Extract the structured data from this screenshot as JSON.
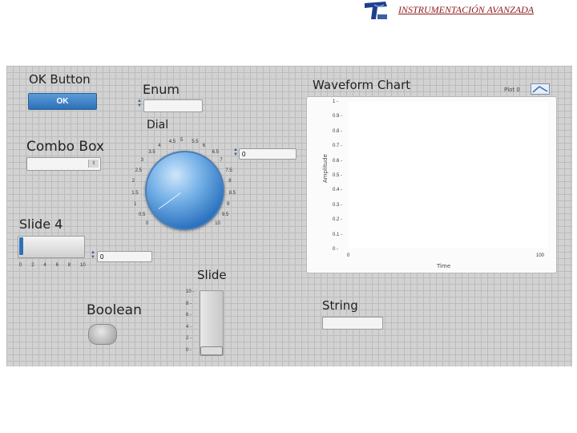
{
  "header": {
    "title": "INSTRUMENTACIÓN AVANZADA",
    "logo_icon": "institution-logo-icon"
  },
  "controls": {
    "ok_button": {
      "label": "OK Button",
      "text": "OK"
    },
    "enum": {
      "label": "Enum",
      "value": ""
    },
    "dial": {
      "label": "Dial",
      "value": "0",
      "ticks": [
        "0",
        "0.5",
        "1",
        "1.5",
        "2",
        "2.5",
        "3",
        "3.5",
        "4",
        "4.5",
        "5",
        "5.5",
        "6",
        "6.5",
        "7",
        "7.5",
        "8",
        "8.5",
        "9",
        "9.5",
        "10"
      ],
      "level": 0.4
    },
    "combo_box": {
      "label": "Combo Box",
      "value": ""
    },
    "slide4": {
      "label": "Slide 4",
      "value": "0",
      "ticks": [
        "0",
        "2",
        "4",
        "6",
        "8",
        "10"
      ]
    },
    "slide": {
      "label": "Slide",
      "ticks": [
        "10",
        "8",
        "6",
        "4",
        "2",
        "0"
      ]
    },
    "boolean": {
      "label": "Boolean"
    },
    "string": {
      "label": "String",
      "value": ""
    }
  },
  "waveform_chart": {
    "label": "Waveform Chart",
    "legend": "Plot 0",
    "xlabel": "Time",
    "ylabel": "Amplitude",
    "y_ticks": [
      "1",
      "0.9",
      "0.8",
      "0.7",
      "0.6",
      "0.5",
      "0.4",
      "0.3",
      "0.2",
      "0.1",
      "0"
    ],
    "x_ticks": [
      "0",
      "100"
    ]
  },
  "chart_data": {
    "type": "line",
    "title": "Waveform Chart",
    "xlabel": "Time",
    "ylabel": "Amplitude",
    "ylim": [
      0,
      1
    ],
    "xlim": [
      0,
      100
    ],
    "series": [
      {
        "name": "Plot 0",
        "values": []
      }
    ],
    "grid": false,
    "legend": "top-right"
  }
}
